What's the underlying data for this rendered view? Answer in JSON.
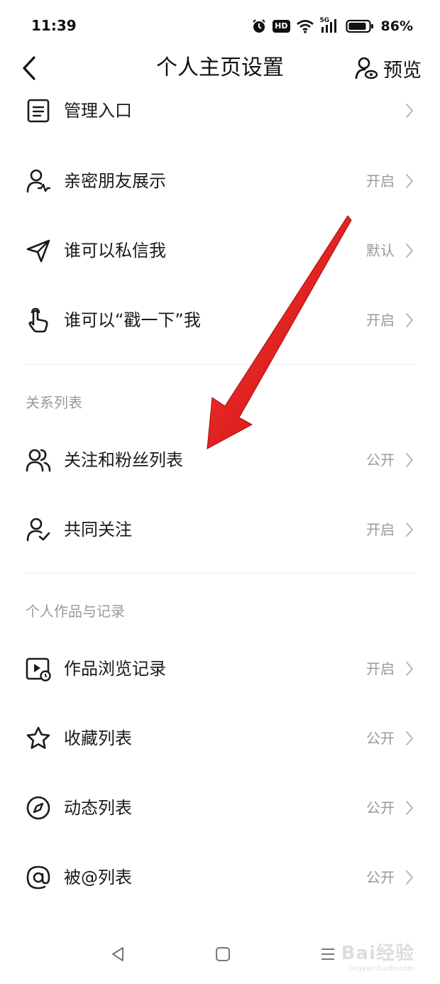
{
  "status_bar": {
    "time": "11:39",
    "network": "5G",
    "hd_badge": "HD",
    "battery": "86%"
  },
  "header": {
    "title": "个人主页设置",
    "preview_label": "预览"
  },
  "top_items": [
    {
      "label": "管理入口",
      "value": "",
      "icon": "list-icon"
    },
    {
      "label": "亲密朋友展示",
      "value": "开启",
      "icon": "user-heart-icon"
    },
    {
      "label": "谁可以私信我",
      "value": "默认",
      "icon": "send-icon"
    },
    {
      "label": "谁可以“戳一下”我",
      "value": "开启",
      "icon": "tap-hand-icon"
    }
  ],
  "sections": {
    "relations": {
      "title": "关系列表",
      "items": [
        {
          "label": "关注和粉丝列表",
          "value": "公开",
          "icon": "users-icon"
        },
        {
          "label": "共同关注",
          "value": "开启",
          "icon": "user-check-icon"
        }
      ]
    },
    "works": {
      "title": "个人作品与记录",
      "items": [
        {
          "label": "作品浏览记录",
          "value": "开启",
          "icon": "video-history-icon"
        },
        {
          "label": "收藏列表",
          "value": "公开",
          "icon": "star-icon"
        },
        {
          "label": "动态列表",
          "value": "公开",
          "icon": "compass-icon"
        },
        {
          "label": "被@列表",
          "value": "公开",
          "icon": "at-icon"
        }
      ]
    }
  },
  "annotation": {
    "color": "#e3151a",
    "icon": "red-arrow-annotation"
  },
  "watermark": {
    "line1": "Bai经验",
    "line2": "jingyan.baidu.com"
  }
}
